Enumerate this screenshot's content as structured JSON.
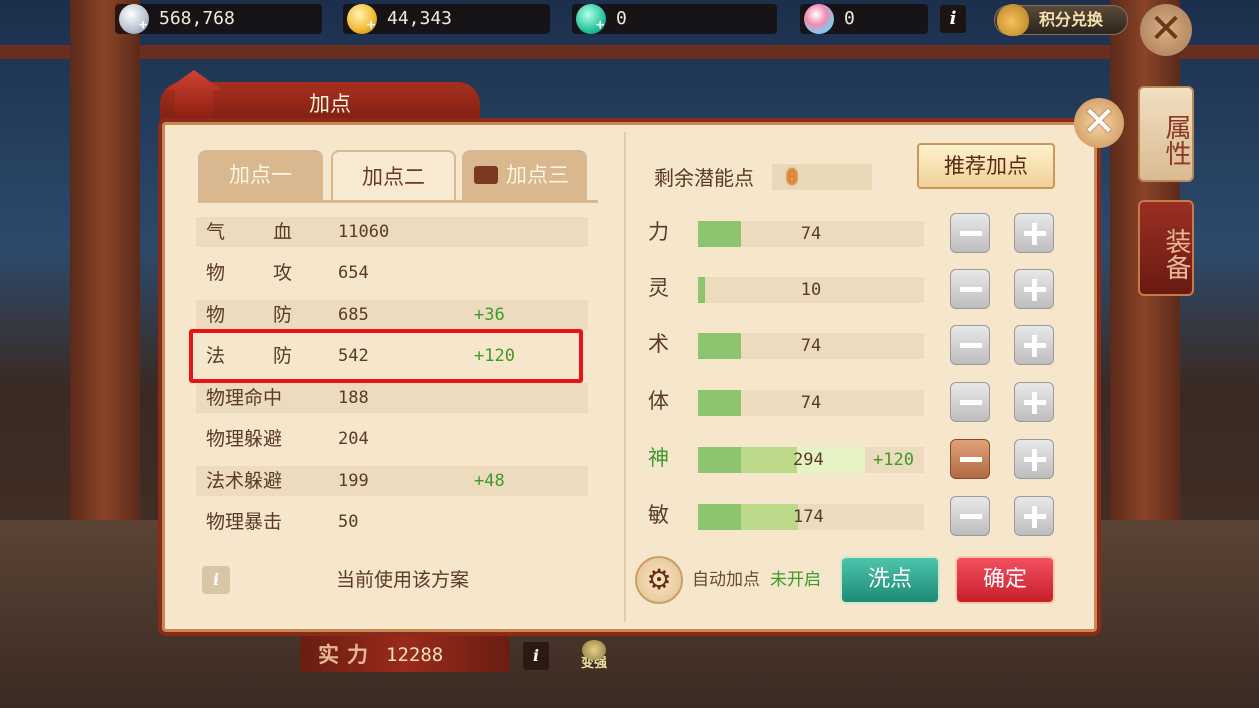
{
  "resources": {
    "silver": "568,768",
    "gold": "44,343",
    "jade": "0",
    "gem": "0",
    "info": "i",
    "points_exchange": "积分兑换"
  },
  "side_tabs": {
    "attributes": "属性",
    "equipment": "装备"
  },
  "dialog": {
    "title": "加点",
    "tabs": [
      "加点一",
      "加点二",
      "加点三"
    ],
    "active_tab": "加点二",
    "stats": [
      {
        "label": "气血",
        "value": "11060",
        "bonus": ""
      },
      {
        "label": "物攻",
        "value": "654",
        "bonus": ""
      },
      {
        "label": "物防",
        "value": "685",
        "bonus": "+36"
      },
      {
        "label": "法防",
        "value": "542",
        "bonus": "+120"
      },
      {
        "label": "物理命中",
        "value": "188",
        "bonus": ""
      },
      {
        "label": "物理躲避",
        "value": "204",
        "bonus": ""
      },
      {
        "label": "法术躲避",
        "value": "199",
        "bonus": "+48"
      },
      {
        "label": "物理暴击",
        "value": "50",
        "bonus": ""
      }
    ],
    "stat_labels_display": [
      "气 血",
      "物 攻",
      "物 防",
      "法 防",
      "物理命中",
      "物理躲避",
      "法术躲避",
      "物理暴击"
    ],
    "info_icon": "i",
    "current_scheme_text": "当前使用该方案",
    "remaining_points_label": "剩余潜能点",
    "remaining_points_value": "0",
    "recommend_button": "推荐加点",
    "attributes": [
      {
        "name": "力",
        "value": "74",
        "bonus": "",
        "fraction": 0.19
      },
      {
        "name": "灵",
        "value": "10",
        "bonus": "",
        "fraction": 0.03
      },
      {
        "name": "术",
        "value": "74",
        "bonus": "",
        "fraction": 0.19
      },
      {
        "name": "体",
        "value": "74",
        "bonus": "",
        "fraction": 0.19
      },
      {
        "name": "神",
        "value": "294",
        "bonus": "+120",
        "fraction": 0.44
      },
      {
        "name": "敏",
        "value": "174",
        "bonus": "",
        "fraction": 0.44
      }
    ],
    "auto_point_label": "自动加点",
    "auto_point_status": "未开启",
    "wash_button": "洗点",
    "confirm_button": "确定"
  },
  "power": {
    "label": "实力",
    "value": "12288",
    "info": "i",
    "strengthen": "变强"
  },
  "colors": {
    "highlight": "#e8141a",
    "bonus_green": "#3e9a2a",
    "bar_fill": "#8dc46e"
  }
}
